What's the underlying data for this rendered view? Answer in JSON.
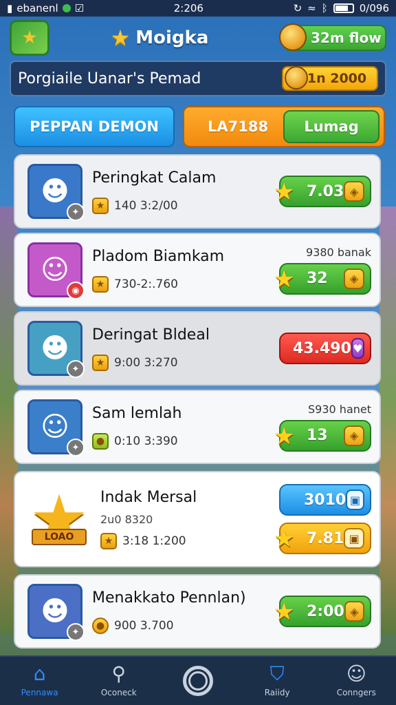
{
  "status_bar": {
    "carrier": "ebanenl",
    "time": "2:206",
    "battery": "0/096"
  },
  "header": {
    "title": "Moigka",
    "currency": "32m flow"
  },
  "info_bar": {
    "text": "Porgiaile Uanar's Pemad",
    "value": "1n 2000"
  },
  "tabs": {
    "primary": "PEPPAN DEMON",
    "secondary": "LA7188",
    "secondary_sub": "Lumag"
  },
  "list": [
    {
      "name": "Peringkat Calam",
      "meta": "140 3:2/00",
      "side_label": "",
      "score": "7.03",
      "style": "green",
      "avatar_bg": "#3a79c9",
      "avatar_icon": "☻"
    },
    {
      "name": "Pladom Biamkam",
      "meta": "730-2:.760",
      "side_label": "9380 banak",
      "score": "32",
      "style": "green",
      "avatar_bg": "#c45ac9",
      "avatar_icon": "☺"
    },
    {
      "name": "Deringat Bldeal",
      "meta": "9:00 3:270",
      "side_label": "",
      "score": "43.490",
      "style": "red",
      "avatar_bg": "#46a0c4",
      "avatar_icon": "☻"
    },
    {
      "name": "Sam lemlah",
      "meta": "0:10 3:390",
      "side_label": "S930 hanet",
      "score": "13",
      "style": "green",
      "avatar_bg": "#3b7ec9",
      "avatar_icon": "☺"
    }
  ],
  "featured": {
    "name": "Indak Mersal",
    "sub": "2u0 8320",
    "meta": "3:18 1:200",
    "ribbon": "LOAO",
    "score_top": "3010",
    "score_bottom": "7.81"
  },
  "last_item": {
    "name": "Menakkato Pennlan)",
    "meta": "900 3.700",
    "score": "2:00",
    "avatar_bg": "#4b6fc4",
    "avatar_icon": "☻"
  },
  "bottom_nav": [
    {
      "label": "Pennawa",
      "icon": "home-icon",
      "active": true
    },
    {
      "label": "Oconeck",
      "icon": "search-icon",
      "active": false
    },
    {
      "label": "",
      "icon": "circle-icon",
      "active": false
    },
    {
      "label": "Raiidy",
      "icon": "shield-icon",
      "active": false
    },
    {
      "label": "Conngers",
      "icon": "profile-icon",
      "active": false
    }
  ]
}
